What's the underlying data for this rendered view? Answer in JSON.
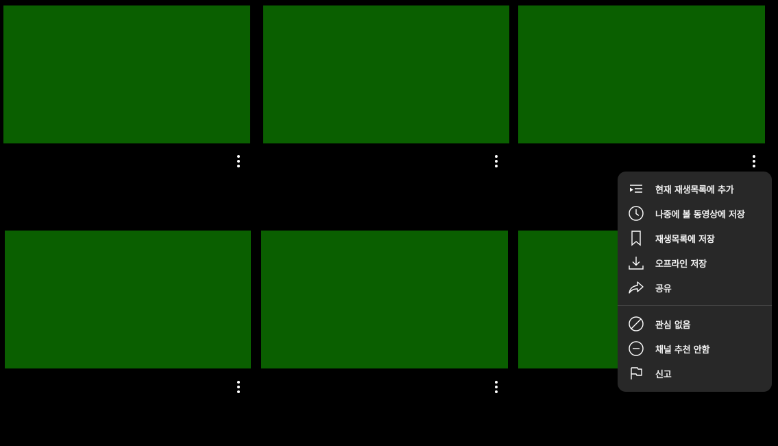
{
  "colors": {
    "background": "#000000",
    "thumbnail": "#0a5f00",
    "menu_background": "#282828",
    "menu_text": "#f1f1f1",
    "divider": "#4a4a4a"
  },
  "video_grid": {
    "cards": [
      {
        "thumbnail": "green-placeholder",
        "more_icon": "more-vertical-icon"
      },
      {
        "thumbnail": "green-placeholder",
        "more_icon": "more-vertical-icon"
      },
      {
        "thumbnail": "green-placeholder",
        "more_icon": "more-vertical-icon"
      },
      {
        "thumbnail": "green-placeholder",
        "more_icon": "more-vertical-icon"
      },
      {
        "thumbnail": "green-placeholder",
        "more_icon": "more-vertical-icon"
      },
      {
        "thumbnail": "green-placeholder"
      }
    ]
  },
  "context_menu": {
    "items": [
      {
        "label": "현재 재생목록에 추가",
        "icon": "add-to-queue-icon"
      },
      {
        "label": "나중에 볼 동영상에 저장",
        "icon": "clock-icon"
      },
      {
        "label": "재생목록에 저장",
        "icon": "bookmark-icon"
      },
      {
        "label": "오프라인 저장",
        "icon": "download-icon"
      },
      {
        "label": "공유",
        "icon": "share-icon"
      },
      {
        "label": "관심 없음",
        "icon": "not-interested-icon"
      },
      {
        "label": "채널 추천 안함",
        "icon": "do-not-recommend-icon"
      },
      {
        "label": "신고",
        "icon": "flag-icon"
      }
    ]
  }
}
